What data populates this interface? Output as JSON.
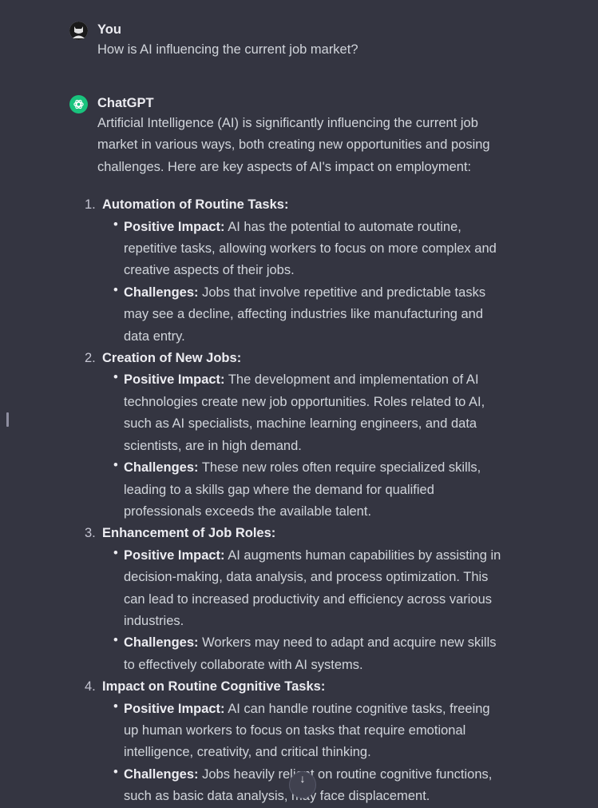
{
  "user_message": {
    "author": "You",
    "text": "How is AI influencing the current job market?"
  },
  "assistant_message": {
    "author": "ChatGPT",
    "intro": "Artificial Intelligence (AI) is significantly influencing the current job market in various ways, both creating new opportunities and posing challenges. Here are key aspects of AI's impact on employment:",
    "items": [
      {
        "num": "1.",
        "title": "Automation of Routine Tasks:",
        "bullets": [
          {
            "label": "Positive Impact:",
            "text": " AI has the potential to automate routine, repetitive tasks, allowing workers to focus on more complex and creative aspects of their jobs."
          },
          {
            "label": "Challenges:",
            "text": " Jobs that involve repetitive and predictable tasks may see a decline, affecting industries like manufacturing and data entry."
          }
        ]
      },
      {
        "num": "2.",
        "title": "Creation of New Jobs:",
        "bullets": [
          {
            "label": "Positive Impact:",
            "text": " The development and implementation of AI technologies create new job opportunities. Roles related to AI, such as AI specialists, machine learning engineers, and data scientists, are in high demand."
          },
          {
            "label": "Challenges:",
            "text": " These new roles often require specialized skills, leading to a skills gap where the demand for qualified professionals exceeds the available talent."
          }
        ]
      },
      {
        "num": "3.",
        "title": "Enhancement of Job Roles:",
        "bullets": [
          {
            "label": "Positive Impact:",
            "text": " AI augments human capabilities by assisting in decision-making, data analysis, and process optimization. This can lead to increased productivity and efficiency across various industries."
          },
          {
            "label": "Challenges:",
            "text": " Workers may need to adapt and acquire new skills to effectively collaborate with AI systems."
          }
        ]
      },
      {
        "num": "4.",
        "title": "Impact on Routine Cognitive Tasks:",
        "bullets": [
          {
            "label": "Positive Impact:",
            "text": " AI can handle routine cognitive tasks, freeing up human workers to focus on tasks that require emotional intelligence, creativity, and critical thinking."
          },
          {
            "label": "Challenges:",
            "text": " Jobs heavily reliant on routine cognitive functions, such as basic data analysis, may face displacement."
          }
        ]
      }
    ]
  },
  "colors": {
    "background": "#343541",
    "chatgpt_avatar": "#19c37d"
  }
}
